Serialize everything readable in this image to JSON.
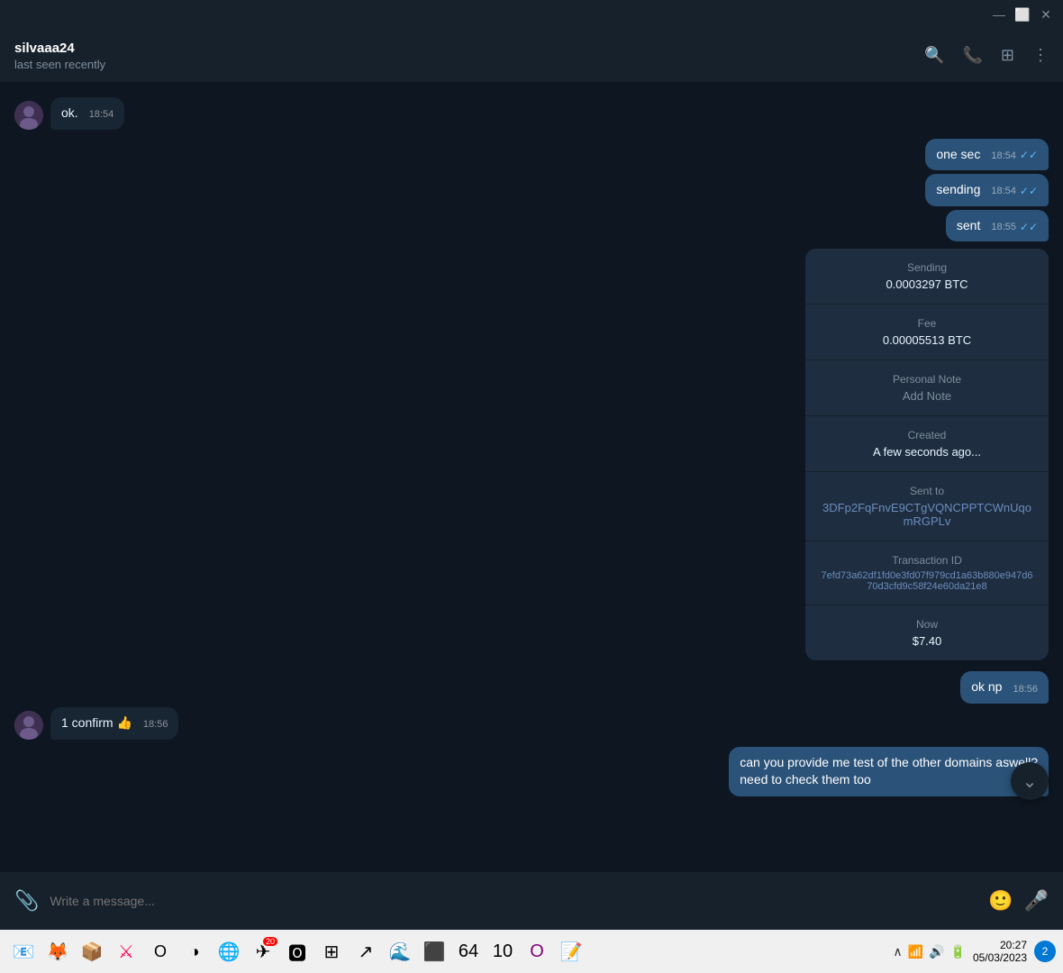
{
  "titlebar": {
    "minimize_icon": "—",
    "maximize_icon": "⬜",
    "close_icon": "✕"
  },
  "header": {
    "name": "silvaaa24",
    "status": "last seen recently"
  },
  "messages": [
    {
      "id": "msg1",
      "type": "incoming",
      "text": "ok.",
      "time": "18:54",
      "has_avatar": true
    },
    {
      "id": "msg2",
      "type": "outgoing",
      "text": "one sec",
      "time": "18:54",
      "has_check": true
    },
    {
      "id": "msg3",
      "type": "outgoing",
      "text": "sending",
      "time": "18:54",
      "has_check": true
    },
    {
      "id": "msg4",
      "type": "outgoing",
      "text": "sent",
      "time": "18:55",
      "has_check": true
    }
  ],
  "tx_card": {
    "sending_label": "Sending",
    "sending_value": "0.0003297 BTC",
    "fee_label": "Fee",
    "fee_value": "0.00005513 BTC",
    "personal_note_label": "Personal Note",
    "personal_note_value": "Add Note",
    "created_label": "Created",
    "created_value": "A few seconds ago...",
    "sent_to_label": "Sent to",
    "sent_to_value": "3DFp2FqFnvE9CTgVQNCPPTCWnUqomRGPLv",
    "tx_id_label": "Transaction ID",
    "tx_id_value": "7efd73a62df1fd0e3fd07f979cd1a63b880e947d670d3cfd9c58f24e60da21e8",
    "now_label": "Now",
    "now_value": "$7.40"
  },
  "later_messages": [
    {
      "id": "msg5",
      "type": "outgoing",
      "text": "ok np",
      "time": "18:56"
    },
    {
      "id": "msg6",
      "type": "incoming",
      "text": "1 confirm 👍",
      "time": "18:56",
      "has_avatar": true
    },
    {
      "id": "msg7",
      "type": "outgoing",
      "text": "can you provide me test of the other domains aswell?\nneed to check them too",
      "time": ""
    }
  ],
  "input": {
    "placeholder": "Write a message..."
  },
  "taskbar": {
    "time": "20:27",
    "date": "05/03/2023",
    "notification_count": "20",
    "battery_icon": "🔋",
    "wifi_icon": "📶",
    "volume_icon": "🔊"
  }
}
